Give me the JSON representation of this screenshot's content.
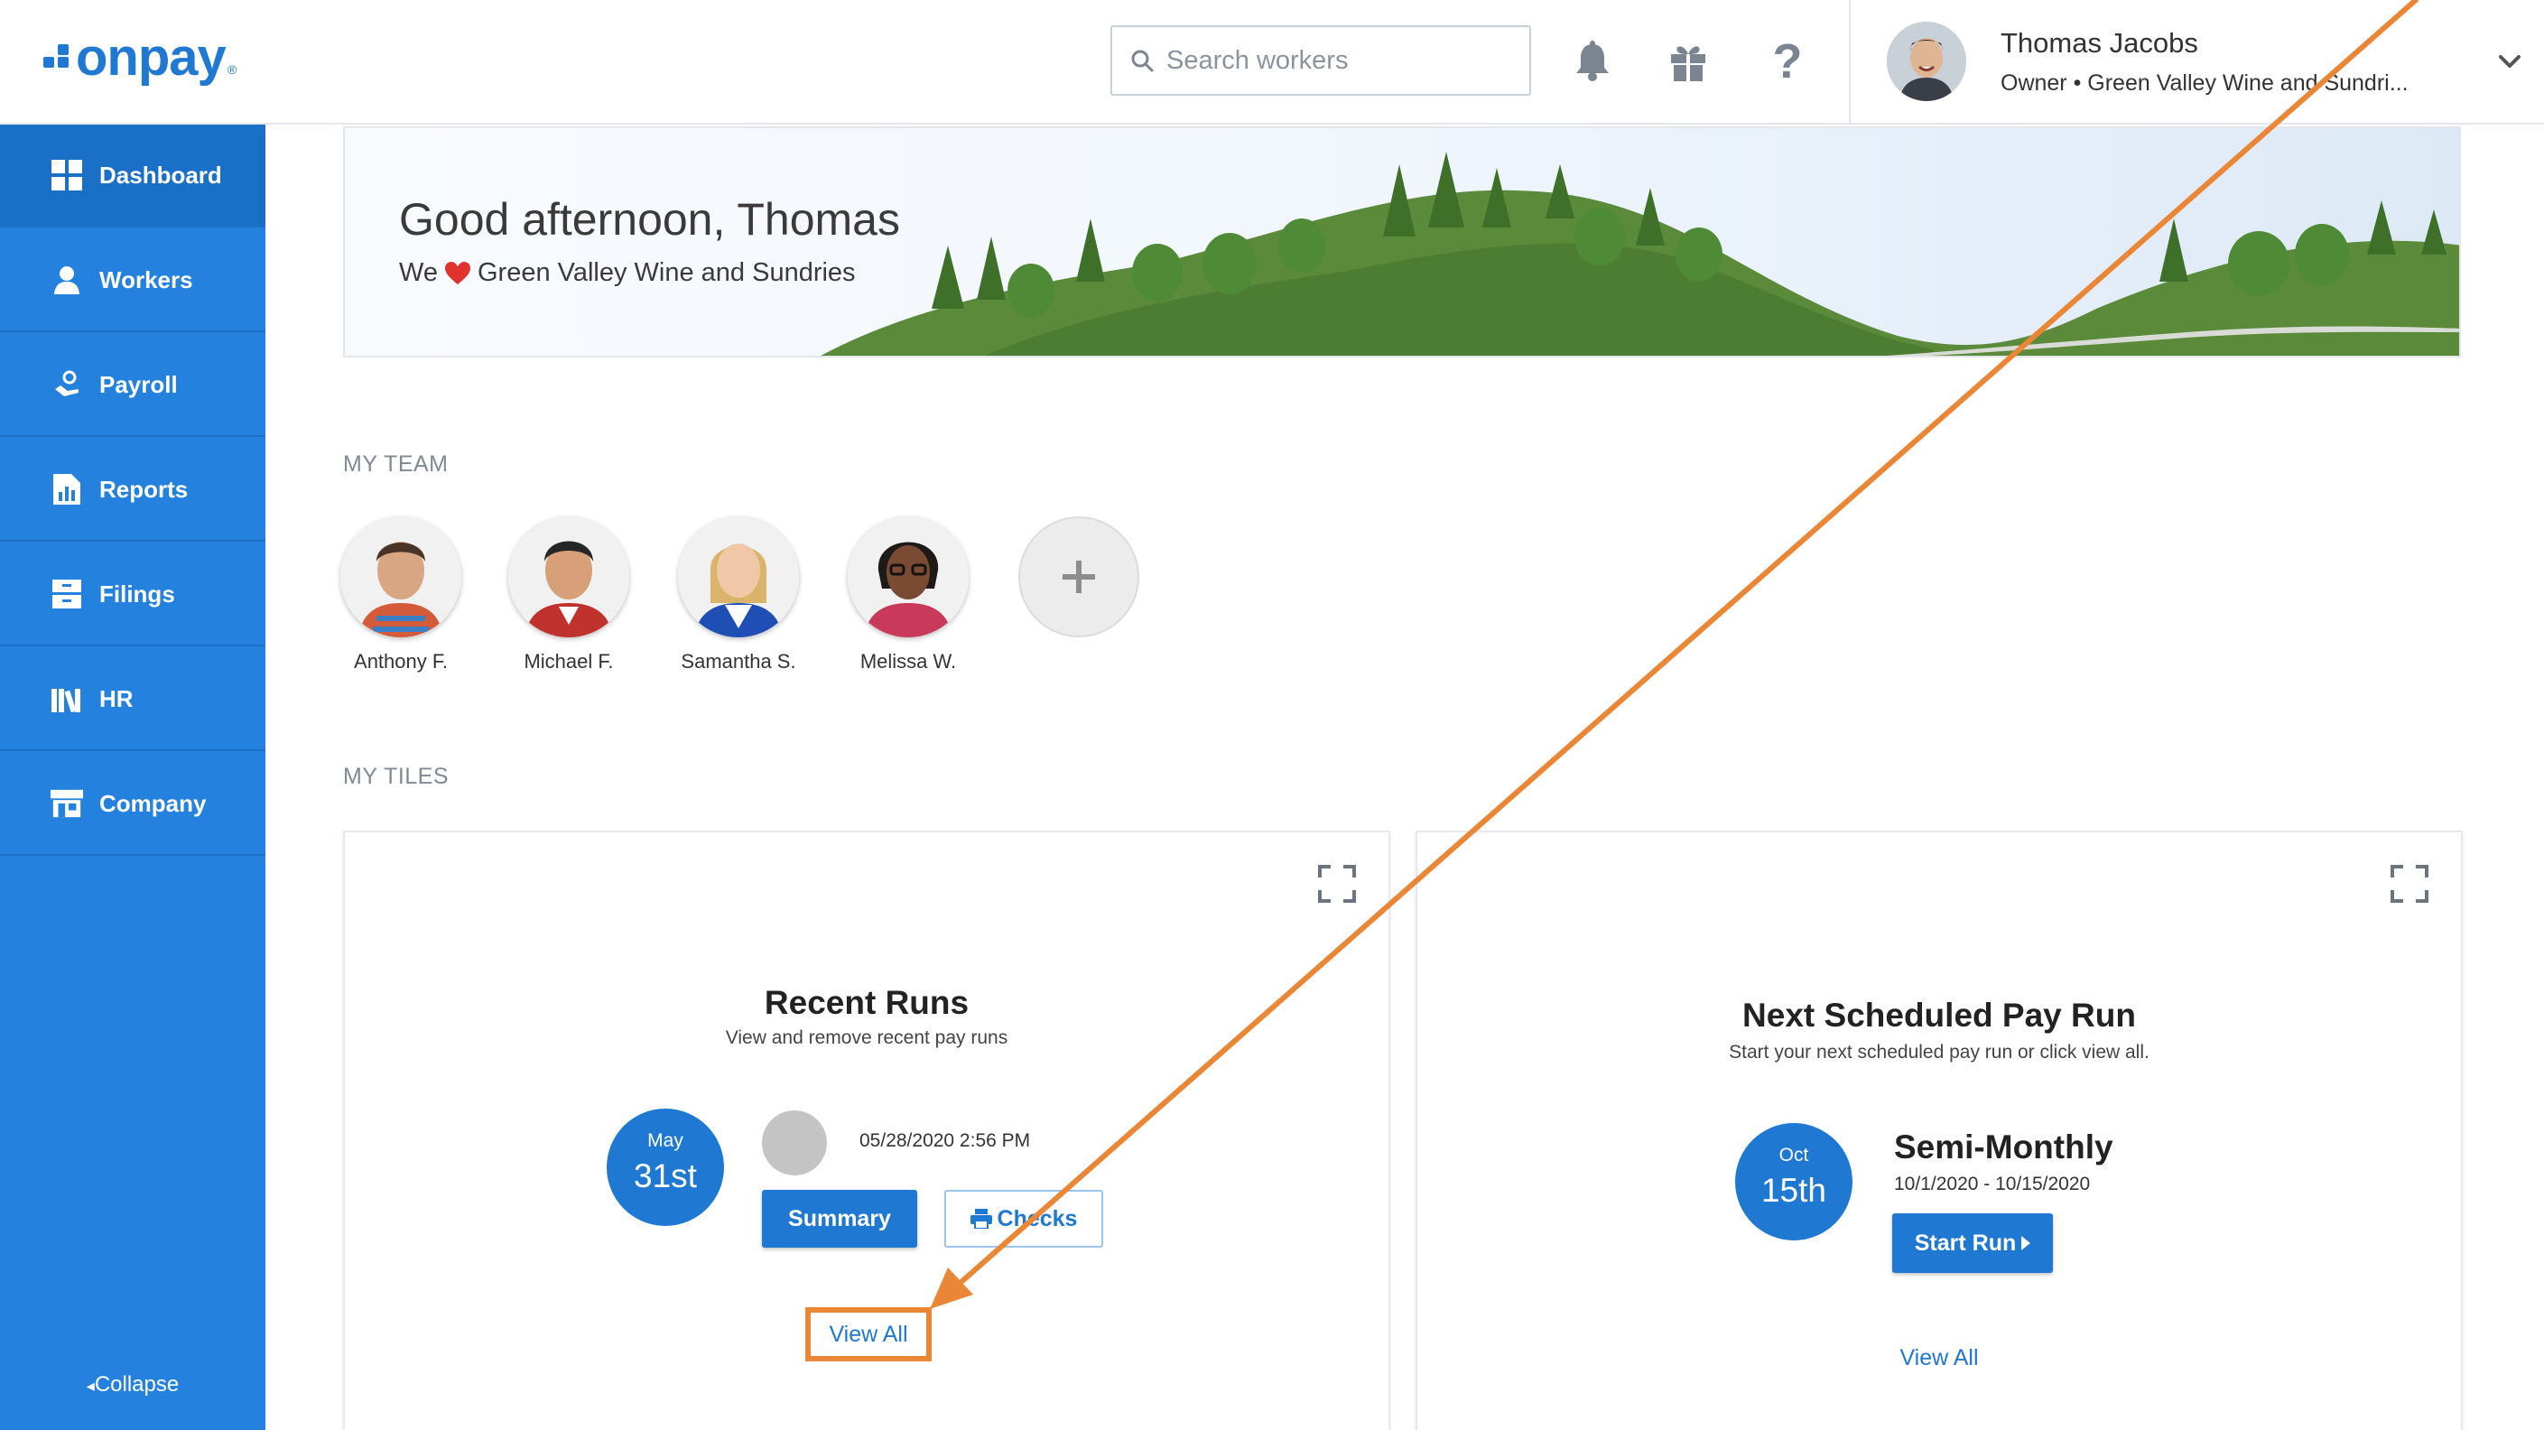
{
  "brand": {
    "logo_text": "onpay",
    "registered": "®",
    "color": "#1f78d1"
  },
  "header": {
    "search_placeholder": "Search workers",
    "icons": [
      "bell-icon",
      "gift-icon",
      "help-icon"
    ],
    "help_glyph": "?",
    "user": {
      "name": "Thomas Jacobs",
      "role": "Owner • Green Valley Wine and Sundri..."
    }
  },
  "sidebar": {
    "items": [
      {
        "label": "Dashboard",
        "icon": "dashboard-icon",
        "active": true
      },
      {
        "label": "Workers",
        "icon": "workers-icon"
      },
      {
        "label": "Payroll",
        "icon": "payroll-icon"
      },
      {
        "label": "Reports",
        "icon": "reports-icon"
      },
      {
        "label": "Filings",
        "icon": "filings-icon"
      },
      {
        "label": "HR",
        "icon": "hr-icon"
      },
      {
        "label": "Company",
        "icon": "company-icon"
      }
    ],
    "collapse_label": "Collapse",
    "collapse_glyph": "◂",
    "color": "#2482de"
  },
  "banner": {
    "greeting": "Good afternoon, Thomas",
    "we": "We",
    "company": "Green Valley Wine and Sundries"
  },
  "team": {
    "title": "MY TEAM",
    "members": [
      {
        "name": "Anthony F."
      },
      {
        "name": "Michael F."
      },
      {
        "name": "Samantha S."
      },
      {
        "name": "Melissa W."
      }
    ]
  },
  "tiles": {
    "title": "MY TILES",
    "recent_runs": {
      "title": "Recent Runs",
      "subtitle": "View and remove recent pay runs",
      "month": "May",
      "day": "31st",
      "timestamp": "05/28/2020 2:56 PM",
      "summary_label": "Summary",
      "checks_label": "Checks",
      "view_all_label": "View All"
    },
    "next_run": {
      "title": "Next Scheduled Pay Run",
      "subtitle": "Start your next scheduled pay run or click view all.",
      "month": "Oct",
      "day": "15th",
      "schedule_name": "Semi-Monthly",
      "date_range": "10/1/2020 - 10/15/2020",
      "start_label": "Start Run",
      "view_all_label": "View All"
    }
  },
  "annotation": {
    "color": "#ea8736"
  }
}
